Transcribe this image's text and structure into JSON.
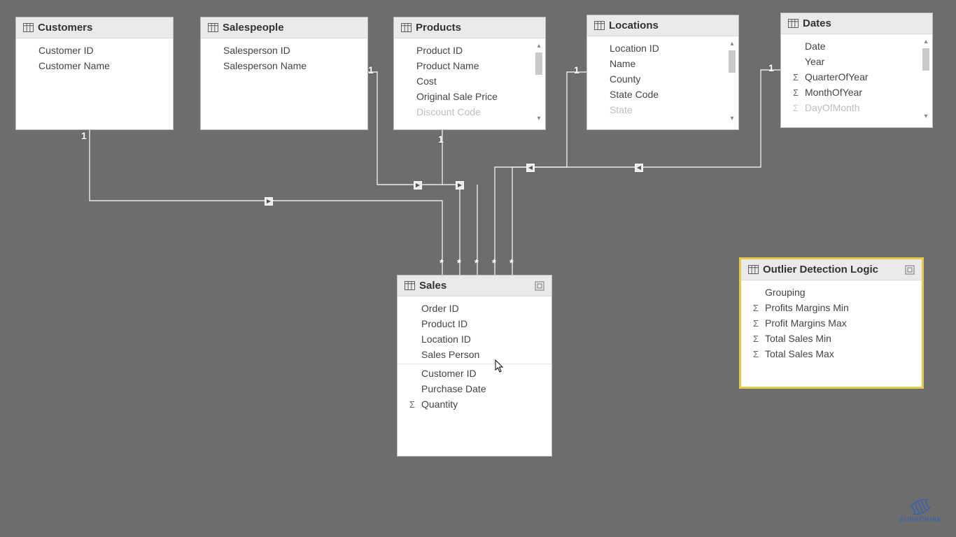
{
  "tables": {
    "customers": {
      "title": "Customers",
      "fields": [
        {
          "name": "Customer ID",
          "sigma": false
        },
        {
          "name": "Customer Name",
          "sigma": false
        }
      ]
    },
    "salespeople": {
      "title": "Salespeople",
      "fields": [
        {
          "name": "Salesperson ID",
          "sigma": false
        },
        {
          "name": "Salesperson Name",
          "sigma": false
        }
      ]
    },
    "products": {
      "title": "Products",
      "fields": [
        {
          "name": "Product ID",
          "sigma": false
        },
        {
          "name": "Product Name",
          "sigma": false
        },
        {
          "name": "Cost",
          "sigma": false
        },
        {
          "name": "Original Sale Price",
          "sigma": false
        },
        {
          "name": "Discount Code",
          "sigma": false
        }
      ]
    },
    "locations": {
      "title": "Locations",
      "fields": [
        {
          "name": "Location ID",
          "sigma": false
        },
        {
          "name": "Name",
          "sigma": false
        },
        {
          "name": "County",
          "sigma": false
        },
        {
          "name": "State Code",
          "sigma": false
        },
        {
          "name": "State",
          "sigma": false
        }
      ]
    },
    "dates": {
      "title": "Dates",
      "fields": [
        {
          "name": "Date",
          "sigma": false
        },
        {
          "name": "Year",
          "sigma": false
        },
        {
          "name": "QuarterOfYear",
          "sigma": true
        },
        {
          "name": "MonthOfYear",
          "sigma": true
        },
        {
          "name": "DayOfMonth",
          "sigma": true
        }
      ]
    },
    "sales": {
      "title": "Sales",
      "fields_top": [
        {
          "name": "Order ID",
          "sigma": false
        },
        {
          "name": "Product ID",
          "sigma": false
        },
        {
          "name": "Location ID",
          "sigma": false
        },
        {
          "name": "Sales Person",
          "sigma": false
        }
      ],
      "fields_bottom": [
        {
          "name": "Customer ID",
          "sigma": false
        },
        {
          "name": "Purchase Date",
          "sigma": false
        },
        {
          "name": "Quantity",
          "sigma": true
        }
      ]
    },
    "outlier": {
      "title": "Outlier Detection Logic",
      "fields": [
        {
          "name": "Grouping",
          "sigma": false
        },
        {
          "name": "Profits Margins Min",
          "sigma": true
        },
        {
          "name": "Profit Margins Max",
          "sigma": true
        },
        {
          "name": "Total Sales Min",
          "sigma": true
        },
        {
          "name": "Total Sales Max",
          "sigma": true
        }
      ]
    }
  },
  "cardinality": {
    "one": "1",
    "many": "*"
  },
  "subscribe": "SUBSCRIBE"
}
